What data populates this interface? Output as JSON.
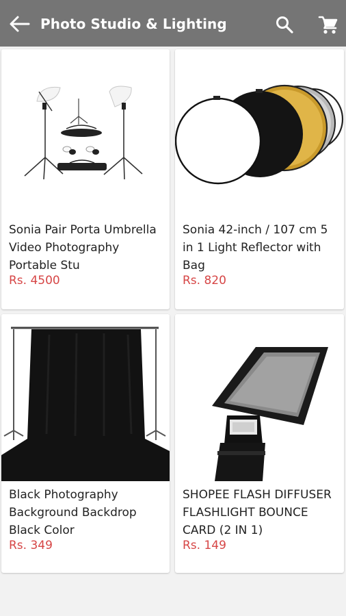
{
  "header": {
    "title": "Photo Studio & Lighting",
    "back_icon": "arrow-left-icon",
    "search_icon": "search-icon",
    "cart_icon": "shopping-cart-icon",
    "bar_color": "#757575"
  },
  "products": [
    {
      "name": "Sonia Pair Porta Umbrella Video Photography Portable Stu",
      "price": "Rs. 4500",
      "image": "umbrella-lighting-kit"
    },
    {
      "name": "Sonia 42-inch / 107 cm 5 in 1 Light Reflector with Bag",
      "price": "Rs. 820",
      "image": "5-in-1-reflector"
    },
    {
      "name": "Black Photography Background Backdrop Black Color",
      "price": "Rs. 349",
      "image": "black-backdrop-stand"
    },
    {
      "name": "SHOPEE FLASH DIFFUSER FLASHLIGHT BOUNCE CARD (2 IN 1)",
      "price": "Rs. 149",
      "image": "flash-diffuser-bounce-card"
    }
  ],
  "colors": {
    "price": "#d64545"
  }
}
